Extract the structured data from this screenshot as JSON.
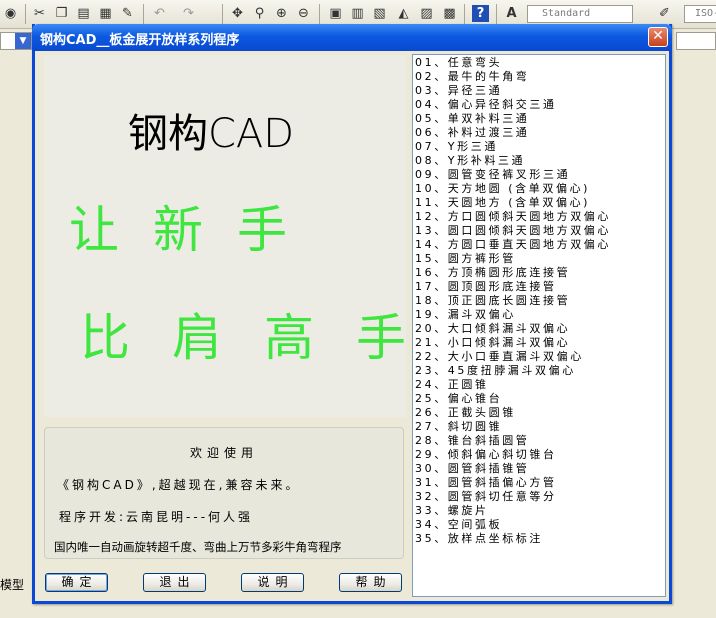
{
  "app": {
    "text_style": "Standard",
    "dim_style": "ISO-",
    "model_tab": "模型"
  },
  "dialog": {
    "title": "钢构CAD__板金展开放样系列程序",
    "close_glyph": "✕",
    "logo_text": "钢构CAD",
    "slogan_line1": "让新手",
    "slogan_line2": "比肩高手",
    "welcome": "欢迎使用",
    "tagline": "《钢构CAD》,超越现在,兼容未来。",
    "developer": "程序开发:云南昆明---何人强",
    "blurb": "国内唯一自动画旋转超千度、弯曲上万节多彩牛角弯程序",
    "buttons": {
      "ok": "确定",
      "exit": "退出",
      "help_doc": "说明",
      "help": "帮助"
    },
    "items": [
      "01、任意弯头",
      "02、最牛的牛角弯",
      "03、异径三通",
      "04、偏心异径斜交三通",
      "05、单双补料三通",
      "06、补料过渡三通",
      "07、Y形三通",
      "08、Y形补料三通",
      "09、圆管变径裤叉形三通",
      "10、天方地圆 (含单双偏心)",
      "11、天圆地方 (含单双偏心)",
      "12、方口圆倾斜天圆地方双偏心",
      "13、圆口圆倾斜天圆地方双偏心",
      "14、方圆口垂直天圆地方双偏心",
      "15、圆方裤形管",
      "16、方顶椭圆形底连接管",
      "17、圆顶圆形底连接管",
      "18、顶正圆底长圆连接管",
      "19、漏斗双偏心",
      "20、大口倾斜漏斗双偏心",
      "21、小口倾斜漏斗双偏心",
      "22、大小口垂直漏斗双偏心",
      "23、45度扭脖漏斗双偏心",
      "24、正圆锥",
      "25、偏心锥台",
      "26、正截头圆锥",
      "27、斜切圆锥",
      "28、锥台斜插圆管",
      "29、倾斜偏心斜切锥台",
      "30、圆管斜插锥管",
      "31、圆管斜插偏心方管",
      "32、圆管斜切任意等分",
      "33、螺旋片",
      "34、空间弧板",
      "35、放样点坐标标注"
    ]
  },
  "colors": {
    "title_bar": "#0b5ae0",
    "slogan": "#3fe63f",
    "close_button": "#c7411c"
  },
  "icons": [
    "globe-icon",
    "cut-icon",
    "copy-icon",
    "paste-icon",
    "match-properties-icon",
    "brush-icon",
    "undo-icon",
    "redo-icon",
    "pan-icon",
    "zoom-realtime-icon",
    "zoom-window-icon",
    "zoom-previous-icon",
    "properties-icon",
    "design-center-icon",
    "tool-palettes-icon",
    "markup-icon",
    "calculator-icon",
    "help-icon",
    "text-style-icon",
    "dim-style-icon"
  ]
}
